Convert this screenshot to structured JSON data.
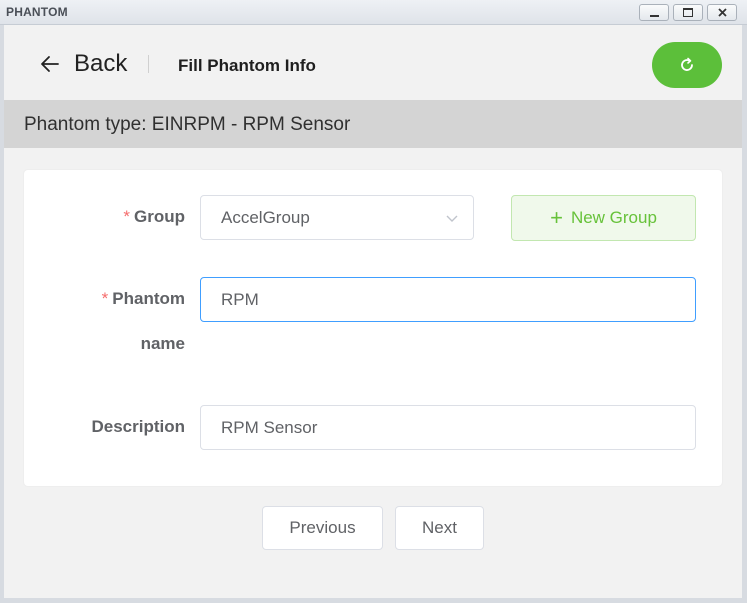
{
  "window": {
    "title": "PHANTOM"
  },
  "header": {
    "back_label": "Back",
    "title": "Fill Phantom Info",
    "refresh_icon": "refresh-icon",
    "accent_color": "#5cbf3a"
  },
  "type_bar": {
    "text": "Phantom type: EINRPM - RPM Sensor"
  },
  "form": {
    "required_mark": "*",
    "group": {
      "label": "Group",
      "value": "AccelGroup"
    },
    "new_group_button": {
      "label": "New Group",
      "icon": "plus-icon"
    },
    "phantom_name": {
      "label_line1": "Phantom",
      "label_line2": "name",
      "value": "RPM"
    },
    "description": {
      "label": "Description",
      "value": "RPM Sensor"
    }
  },
  "footer": {
    "previous_label": "Previous",
    "next_label": "Next"
  }
}
